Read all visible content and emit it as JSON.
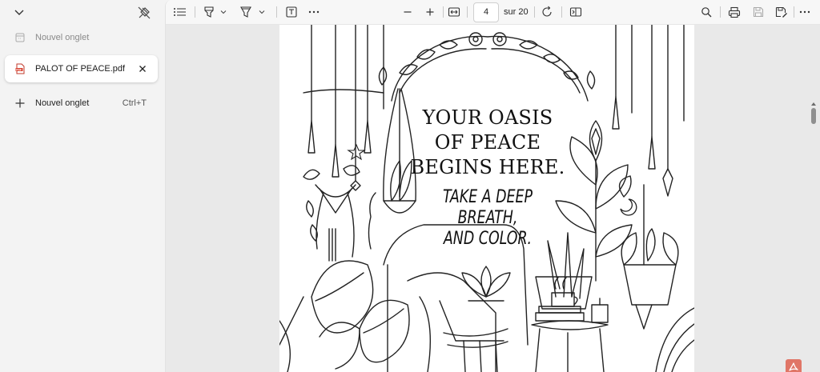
{
  "tabs": [
    {
      "label": "Nouvel onglet",
      "state": "inactive",
      "icon": "page-icon"
    },
    {
      "label": "PALOT OF PEACE.pdf",
      "state": "active",
      "icon": "pdf-file-icon"
    }
  ],
  "new_tab": {
    "label": "Nouvel onglet",
    "shortcut": "Ctrl+T"
  },
  "toolbar": {
    "page_current": "4",
    "page_total": "sur 20"
  },
  "document": {
    "title_line1": "YOUR OASIS",
    "title_line2": "OF PEACE",
    "title_line3": "BEGINS HERE.",
    "sub_line1": "TAKE A DEEP",
    "sub_line2": "BREATH,",
    "sub_line3": "AND COLOR."
  },
  "colors": {
    "accent_pdf": "#e07667",
    "sidebar_bg": "#f3f3f3",
    "toolbar_bg": "#f7f7f7",
    "canvas_bg": "#e9e9e9"
  }
}
